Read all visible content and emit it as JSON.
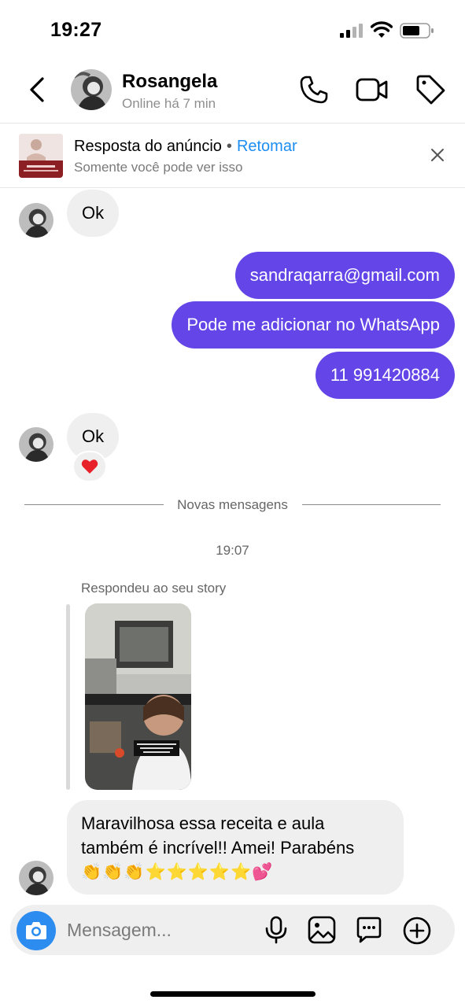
{
  "status_bar": {
    "time": "19:27"
  },
  "header": {
    "name": "Rosangela",
    "status": "Online há 7 min"
  },
  "ad_banner": {
    "title": "Resposta do anúncio",
    "separator": "•",
    "action": "Retomar",
    "subtitle": "Somente você pode ver isso"
  },
  "messages": [
    {
      "direction": "in",
      "text": "Ok"
    },
    {
      "direction": "out",
      "text": "sandraqarra@gmail.com"
    },
    {
      "direction": "out",
      "text": "Pode me adicionar no WhatsApp"
    },
    {
      "direction": "out",
      "text": "11 991420884"
    },
    {
      "direction": "in",
      "text": "Ok",
      "reaction": "❤️"
    }
  ],
  "divider_label": "Novas mensagens",
  "timestamp": "19:07",
  "story_reply": {
    "label": "Respondeu ao seu story",
    "message_line1": "Maravilhosa essa receita e aula",
    "message_line2": "também é incrível!! Amei! Parabéns",
    "message_emojis": "👏👏👏⭐⭐⭐⭐⭐💕"
  },
  "composer": {
    "placeholder": "Mensagem..."
  },
  "colors": {
    "outgoing_bubble": "#6446e8",
    "incoming_bubble": "#efefef",
    "link": "#1c8ef2",
    "camera_button": "#2d8cf0"
  }
}
